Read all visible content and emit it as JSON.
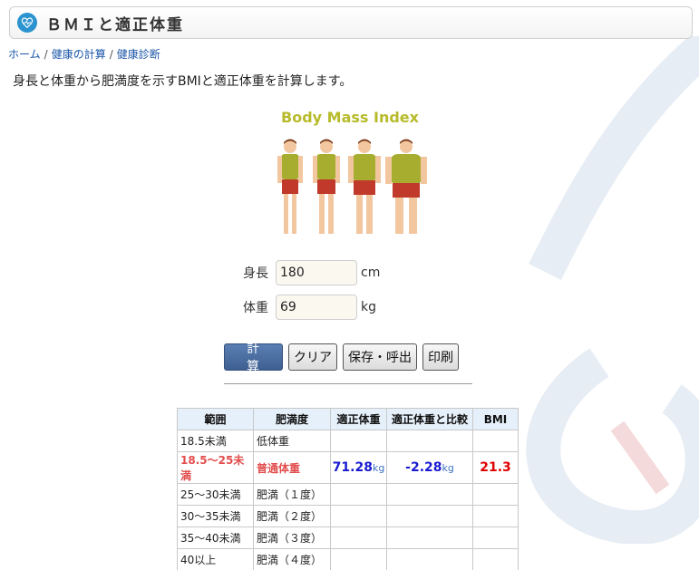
{
  "header": {
    "title": "ＢＭＩと適正体重",
    "icon": "heart-pulse-icon",
    "accent": "#2a93d0"
  },
  "breadcrumb": [
    {
      "label": "ホーム"
    },
    {
      "label": "健康の計算"
    },
    {
      "label": "健康診断"
    }
  ],
  "intro": "身長と体重から肥満度を示すBMIと適正体重を計算します。",
  "illustration": {
    "title": "Body Mass Index"
  },
  "form": {
    "height": {
      "label": "身長",
      "value": "180",
      "unit": "cm"
    },
    "weight": {
      "label": "体重",
      "value": "69",
      "unit": "kg"
    }
  },
  "buttons": {
    "calc": "計 算",
    "clear": "クリア",
    "save": "保存・呼出",
    "print": "印刷"
  },
  "table": {
    "headers": [
      "範囲",
      "肥満度",
      "適正体重",
      "適正体重と比較",
      "BMI"
    ],
    "rows": [
      {
        "range": "18.5未満",
        "category": "低体重"
      },
      {
        "range": "18.5～25未満",
        "category": "普通体重",
        "ideal": "71.28",
        "ideal_unit": "kg",
        "diff": "-2.28",
        "diff_unit": "kg",
        "bmi": "21.3"
      },
      {
        "range": "25～30未満",
        "category": "肥満（１度）"
      },
      {
        "range": "30～35未満",
        "category": "肥満（２度）"
      },
      {
        "range": "35～40未満",
        "category": "肥満（３度）"
      },
      {
        "range": "40以上",
        "category": "肥満（４度）"
      }
    ],
    "highlight_color": "#e24d4d"
  }
}
